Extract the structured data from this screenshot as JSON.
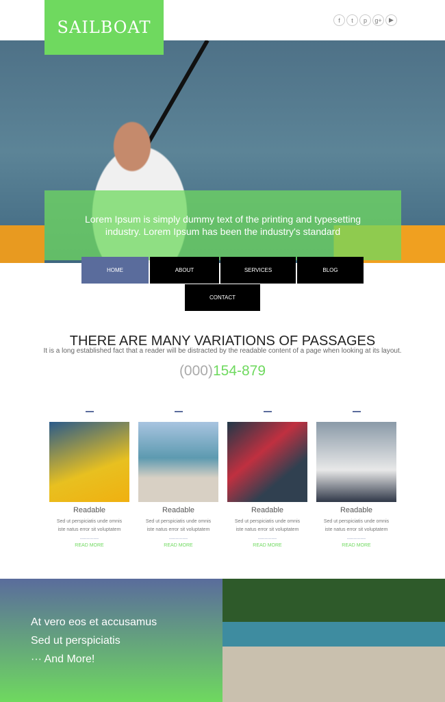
{
  "brand": {
    "logo": "SAILBOAT",
    "color": "#6fd95f",
    "secondary": "#5a6c9c"
  },
  "social": [
    {
      "icon": "facebook-icon",
      "glyph": "f"
    },
    {
      "icon": "twitter-icon",
      "glyph": "t"
    },
    {
      "icon": "pinterest-icon",
      "glyph": "p"
    },
    {
      "icon": "google-plus-icon",
      "glyph": "g+"
    },
    {
      "icon": "youtube-icon",
      "glyph": "▶"
    }
  ],
  "hero": {
    "text": "Lorem Ipsum is simply dummy text of the printing and typesetting industry. Lorem Ipsum has been the industry's standard"
  },
  "nav": [
    "HOME",
    "ABOUT",
    "SERVICES",
    "BLOG",
    "CONTACT"
  ],
  "section": {
    "title": "THERE ARE MANY VARIATIONS OF PASSAGES",
    "subtitle": "It is a long established fact that a reader will be distracted by the readable content of a page when looking at its layout.",
    "phone_prefix": "(000)",
    "phone_number": "154-879"
  },
  "cards": [
    {
      "title": "Readable",
      "text": "Sed ut perspiciatis unde omnis iste natus error sit voluptatem",
      "dots": "..............",
      "link": "READ MORE"
    },
    {
      "title": "Readable",
      "text": "Sed ut perspiciatis unde omnis iste natus error sit voluptatem",
      "dots": "..............",
      "link": "READ MORE"
    },
    {
      "title": "Readable",
      "text": "Sed ut perspiciatis unde omnis iste natus error sit voluptatem",
      "dots": "..............",
      "link": "READ MORE"
    },
    {
      "title": "Readable",
      "text": "Sed ut perspiciatis unde omnis iste natus error sit voluptatem",
      "dots": "..............",
      "link": "READ MORE"
    }
  ],
  "promo": {
    "lines": [
      "At vero eos et accusamus",
      "Sed ut perspiciatis",
      "··· And More!"
    ]
  }
}
